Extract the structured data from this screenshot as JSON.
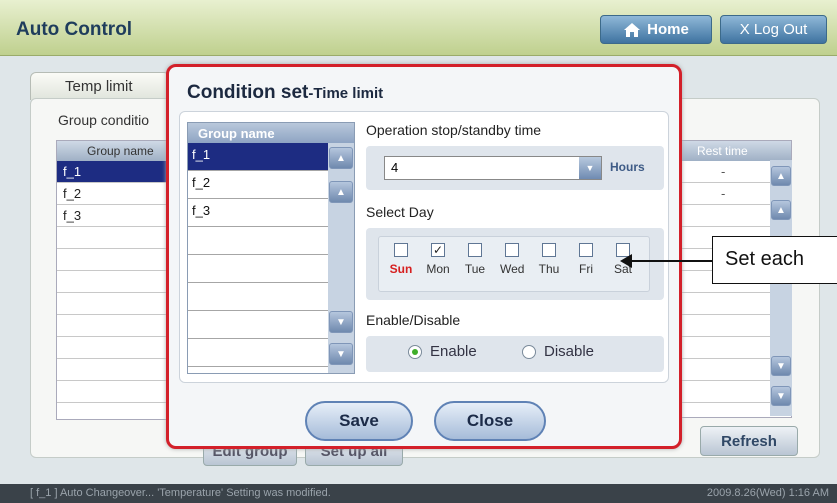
{
  "header": {
    "title": "Auto Control",
    "home_label": "Home",
    "logout_label": "X Log Out"
  },
  "background": {
    "tab_label": "Temp limit",
    "group_condition_label": "Group conditio",
    "group_col_header": "Group name",
    "groups": [
      "f_1",
      "f_2",
      "f_3"
    ],
    "rest_col_header": "Rest time",
    "rest_values": [
      "-",
      "-"
    ],
    "refresh_label": "Refresh",
    "btn1_label": "Edit group",
    "btn2_label": "Set up all"
  },
  "modal": {
    "title": "Condition set",
    "subtitle": "-Time limit",
    "group_header": "Group name",
    "groups": [
      "f_1",
      "f_2",
      "f_3",
      "",
      "",
      "",
      "",
      ""
    ],
    "op_label": "Operation stop/standby time",
    "op_value": "4",
    "op_unit": "Hours",
    "select_day_label": "Select Day",
    "days": [
      {
        "label": "Sun",
        "checked": false
      },
      {
        "label": "Mon",
        "checked": true
      },
      {
        "label": "Tue",
        "checked": false
      },
      {
        "label": "Wed",
        "checked": false
      },
      {
        "label": "Thu",
        "checked": false
      },
      {
        "label": "Fri",
        "checked": false
      },
      {
        "label": "Sat",
        "checked": false
      }
    ],
    "enable_section_label": "Enable/Disable",
    "enable_label": "Enable",
    "disable_label": "Disable",
    "enabled": true,
    "save_label": "Save",
    "close_label": "Close"
  },
  "callout": {
    "text": "Set each"
  },
  "status": {
    "message": "[ f_1 ] Auto Changeover... 'Temperature' Setting was modified.",
    "time": "2009.8.26(Wed)  1:16 AM"
  }
}
